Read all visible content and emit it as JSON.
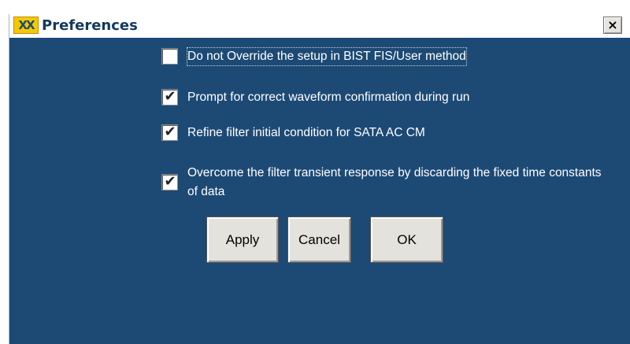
{
  "window": {
    "title": "Preferences",
    "icon_text": "XX",
    "close_glyph": "×"
  },
  "options": [
    {
      "label": "Do not Override the setup in BIST FIS/User method",
      "checked": false
    },
    {
      "label": "Prompt for correct waveform confirmation during run",
      "checked": true
    },
    {
      "label": "Refine filter initial condition for SATA AC CM",
      "checked": true
    },
    {
      "label": "Overcome the filter transient response by discarding the fixed time constants of data",
      "checked": true
    }
  ],
  "buttons": {
    "apply": "Apply",
    "cancel": "Cancel",
    "ok": "OK"
  },
  "colors": {
    "background": "#1d4a75",
    "text": "#ffffff"
  },
  "check_glyph": "✔"
}
